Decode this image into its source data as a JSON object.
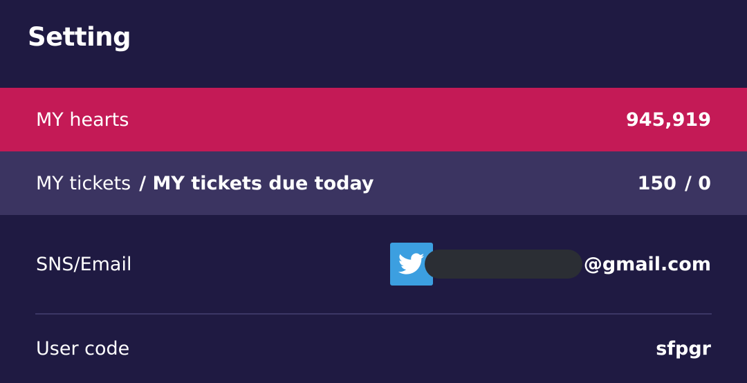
{
  "header": {
    "title": "Setting"
  },
  "hearts": {
    "label": "MY hearts",
    "value": "945,919"
  },
  "tickets": {
    "label": "MY tickets",
    "label_extra": "/ MY tickets due today",
    "value_tickets": "150",
    "value_due": "/ 0"
  },
  "sns": {
    "label": "SNS/Email",
    "provider_icon": "twitter-icon",
    "email_suffix": "@gmail.com"
  },
  "user_code": {
    "label": "User code",
    "value": "sfpgr"
  },
  "colors": {
    "background": "#1f1a42",
    "hearts_row": "#c41a56",
    "tickets_row": "#3b3461",
    "twitter_blue": "#3c9fe0"
  }
}
